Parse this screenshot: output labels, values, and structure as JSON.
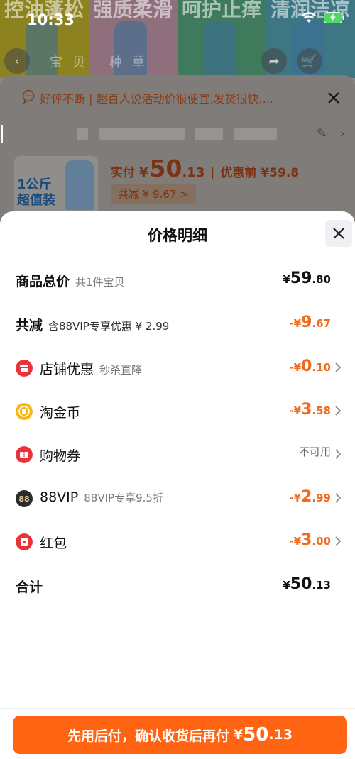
{
  "status_bar": {
    "time": "10:33"
  },
  "background": {
    "banner_words": [
      "控油蓬松",
      "强质柔滑",
      "呵护止痒",
      "清润洁凉"
    ],
    "nav_text": "宝贝 种草",
    "notice": "好评不断 | 超百人说活动价很便宜,发货很快,...",
    "thumb_label_line1": "1公斤",
    "thumb_label_line2": "超值装",
    "actual_label": "实付",
    "actual_currency": "¥",
    "actual_int": "50",
    "actual_dec": ".13",
    "separator": "|",
    "before_price": "优惠前 ¥59.8",
    "reduce_pill": "共减 ¥ 9.67 >"
  },
  "sheet": {
    "title": "价格明细",
    "rows": {
      "total": {
        "label": "商品总价",
        "sub": "共1件宝贝",
        "cur": "¥",
        "int": "59",
        "dec": ".80"
      },
      "reduce": {
        "label": "共减",
        "sub": "含88VIP专享优惠 ¥ 2.99",
        "cur": "-¥",
        "int": "9",
        "dec": ".67"
      },
      "shop": {
        "label": "店铺优惠",
        "sub": "秒杀直降",
        "cur": "-¥",
        "int": "0",
        "dec": ".10"
      },
      "coins": {
        "label": "淘金币",
        "sub": "",
        "cur": "-¥",
        "int": "3",
        "dec": ".58"
      },
      "coupon": {
        "label": "购物券",
        "sub": "",
        "status": "不可用"
      },
      "vip": {
        "label": "88VIP",
        "sub": "88VIP专享9.5折",
        "cur": "-¥",
        "int": "2",
        "dec": ".99",
        "badge": "88"
      },
      "redpacket": {
        "label": "红包",
        "sub": "",
        "cur": "-¥",
        "int": "3",
        "dec": ".00"
      },
      "sum": {
        "label": "合计",
        "cur": "¥",
        "int": "50",
        "dec": ".13"
      }
    }
  },
  "pay_button": {
    "text": "先用后付，确认收货后再付",
    "cur": "¥",
    "int": "50",
    "dec": ".13"
  },
  "colors": {
    "accent": "#ff6413",
    "discount": "#f26b1d",
    "shop_icon": "#e8333a",
    "coin_icon": "#f5b814",
    "vip_icon": "#2b2b2b"
  }
}
